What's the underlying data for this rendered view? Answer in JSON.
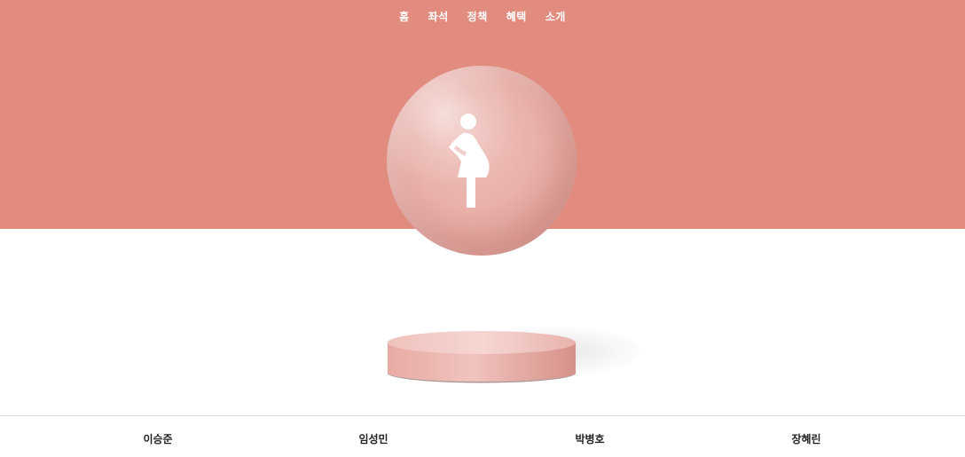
{
  "nav": {
    "items": [
      {
        "label": "홈"
      },
      {
        "label": "좌석"
      },
      {
        "label": "정책"
      },
      {
        "label": "혜택"
      },
      {
        "label": "소개"
      }
    ]
  },
  "hero": {
    "icon": "pregnant-woman-icon",
    "colors": {
      "banner": "#e18c7e",
      "sphere": "#e9b2ab",
      "pedestal": "#eab6b0"
    }
  },
  "footer": {
    "members": [
      {
        "name": "이승준"
      },
      {
        "name": "임성민"
      },
      {
        "name": "박병호"
      },
      {
        "name": "장혜린"
      }
    ]
  }
}
